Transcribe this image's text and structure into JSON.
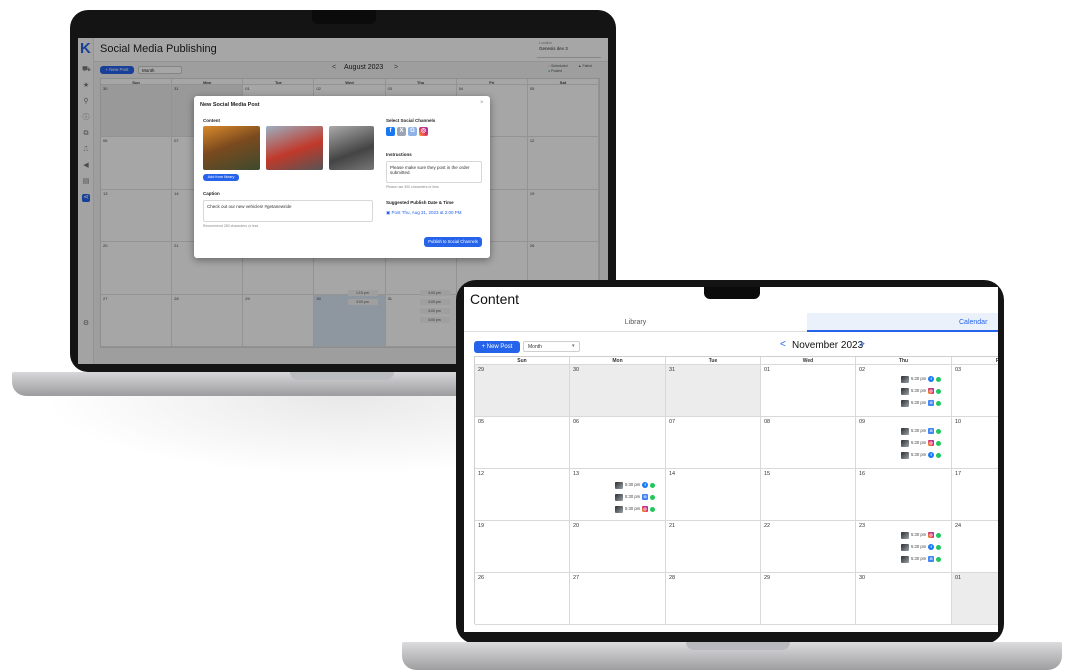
{
  "back_screen": {
    "logo": "K",
    "title": "Social Media Publishing",
    "location_label": "Location",
    "location_value": "Genesis dev 3",
    "new_post": "+ New Post",
    "view": "Month",
    "prev": "<",
    "month": "August 2023",
    "next": ">",
    "legend": {
      "scheduled": "Scheduled",
      "failed": "Failed",
      "posted": "Posted"
    },
    "weekdays": [
      "Sun",
      "Mon",
      "Tue",
      "Wed",
      "Thu",
      "Fri",
      "Sat"
    ],
    "days": [
      "30",
      "31",
      "01",
      "02",
      "03",
      "04",
      "05",
      "06",
      "07",
      "08",
      "09",
      "10",
      "11",
      "12",
      "13",
      "14",
      "15",
      "16",
      "17",
      "18",
      "19",
      "20",
      "21",
      "22",
      "23",
      "24",
      "25",
      "26",
      "27",
      "28",
      "29",
      "30",
      "31",
      "01",
      "02"
    ],
    "events": [
      "1:15 pm",
      "3:00 pm",
      "4:00 pm",
      "4:00 pm",
      "4:00 pm",
      "4:00 pm"
    ],
    "modal": {
      "title": "New Social Media Post",
      "close": "×",
      "content_label": "Content",
      "add_library": "Add from library",
      "caption_label": "Caption",
      "caption_text": "Check out our new vehicles! #getanewride",
      "caption_hint": "Recommend 280 characters or less",
      "channels_label": "Select Social Channels",
      "instructions_label": "Instructions",
      "instructions_text": "Please make sure they post in the order submitted.",
      "instructions_hint": "Please use 300 characters or less",
      "suggested_label": "Suggested Publish Date & Time",
      "suggested_value": "Post Thu, Aug 31, 2023 at 2:00 PM",
      "publish": "Publish to Social Channels"
    }
  },
  "front_screen": {
    "title": "Content",
    "tabs": [
      "Library",
      "Calendar"
    ],
    "new_post": "+ New Post",
    "view": "Month",
    "view_caret": "▾",
    "prev": "<",
    "month": "November 2023",
    "next": ">",
    "weekdays": [
      "Sun",
      "Mon",
      "Tue",
      "Wed",
      "Thu",
      "Fri"
    ],
    "days": [
      "29",
      "30",
      "31",
      "01",
      "02",
      "03",
      "",
      "05",
      "06",
      "07",
      "08",
      "09",
      "10",
      "",
      "12",
      "13",
      "14",
      "15",
      "16",
      "17",
      "",
      "19",
      "20",
      "21",
      "22",
      "23",
      "24",
      "",
      "26",
      "27",
      "28",
      "29",
      "30",
      "01",
      ""
    ],
    "event_time": "5:30 pm"
  },
  "colors": {
    "accent": "#2563eb",
    "facebook": "#1877f2",
    "instagram": "#e1306c",
    "google": "#4285f4",
    "ok": "#22c55e"
  }
}
